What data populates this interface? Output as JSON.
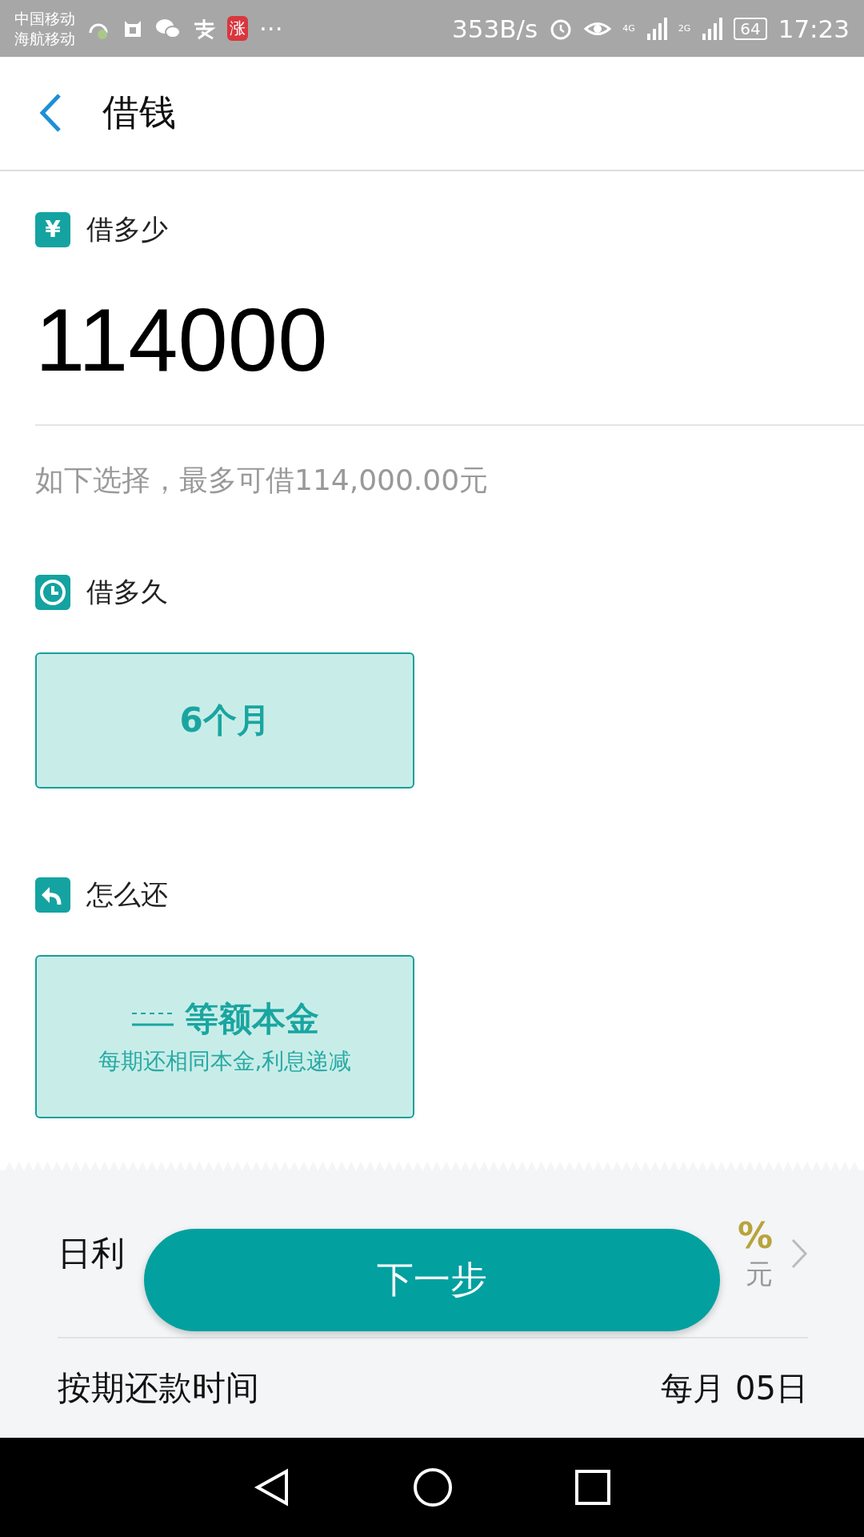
{
  "status_bar": {
    "carriers": [
      "中国移动",
      "海航移动"
    ],
    "badge": "涨",
    "more": "···",
    "speed": "353B/s",
    "network_4g": "4G",
    "network_2g": "2G",
    "battery": "64",
    "time": "17:23"
  },
  "header": {
    "title": "借钱"
  },
  "amount_section": {
    "label": "借多少",
    "icon_glyph": "¥",
    "value": "114000",
    "hint": "如下选择，最多可借114,000.00元"
  },
  "term_section": {
    "label": "借多久",
    "options": [
      {
        "label": "6个月",
        "selected": true
      }
    ]
  },
  "repay_section": {
    "label": "怎么还",
    "options": [
      {
        "title": "等额本金",
        "subtitle": "每期还相同本金,利息递减",
        "selected": true
      }
    ]
  },
  "summary": {
    "rows": [
      {
        "kind": "rate",
        "label": "日利",
        "value": "%",
        "sub": "元"
      },
      {
        "kind": "plain",
        "label": "按期还款时间",
        "value": "每月 05日"
      }
    ]
  },
  "next_button": "下一步"
}
